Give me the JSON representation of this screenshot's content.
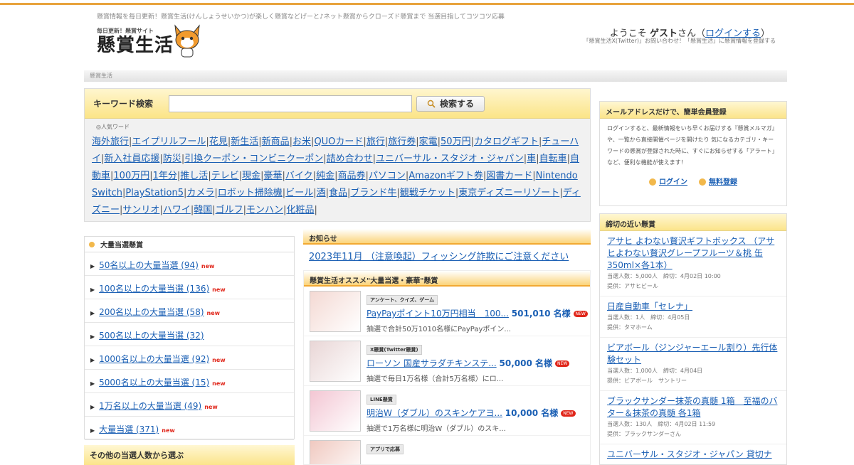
{
  "header": {
    "tagline": "懸賞情報を毎日更新！懸賞生活(けんしょうせいかつ)が楽しく懸賞などげーと♪ネット懸賞からクローズド懸賞まで 当選目指してコツコツ応募",
    "logo_small": "毎日更新！懸賞サイト",
    "logo_main": "懸賞生活",
    "welcome_prefix": "ようこそ",
    "welcome_user": "ゲスト",
    "welcome_suffix": "さん（",
    "login_link": "ログインする",
    "welcome_close": "）",
    "sublinks": "「懸賞生活X(Twitter)」お問い合わせ！「懸賞生活」に懸賞情報を登録する"
  },
  "breadcrumb": "懸賞生活",
  "search": {
    "label": "キーワード検索",
    "value": "",
    "button": "検索する",
    "popular_label": "人気ワード",
    "keywords": [
      "海外旅行",
      "エイプリルフール",
      "花見",
      "新生活",
      "新商品",
      "お米",
      "QUOカード",
      "旅行",
      "旅行券",
      "家電",
      "50万円",
      "カタログギフト",
      "チューハイ",
      "新入社員応援",
      "防災",
      "引換クーポン・コンビニクーポン",
      "詰め合わせ",
      "ユニバーサル・スタジオ・ジャパン",
      "車",
      "自転車",
      "自動車",
      "100万円",
      "1年分",
      "推し活",
      "テレビ",
      "現金",
      "豪華",
      "バイク",
      "純金",
      "商品券",
      "パソコン",
      "Amazonギフト券",
      "図書カード",
      "Nintendo Switch",
      "PlayStation5",
      "カメラ",
      "ロボット掃除機",
      "ビール",
      "酒",
      "食品",
      "ブランド牛",
      "観戦チケット",
      "東京ディズニーリゾート",
      "ディズニー",
      "サンリオ",
      "ハワイ",
      "韓国",
      "ゴルフ",
      "モンハン",
      "化粧品"
    ]
  },
  "member": {
    "title": "メールアドレスだけで、簡単会員登録",
    "text": "ログインすると、最新情報をいち早くお届けする『懸賞メルマガ』や、一覧から直接開催ページを開けたり 気になるカテゴリ・キーワードの懸賞が登録された時に、すぐにお知らせする「アラート」など、便利な機能が使えます！",
    "login": "ログイン",
    "register": "無料登録"
  },
  "deadline": {
    "title": "締切の近い懸賞",
    "items": [
      {
        "title": "アサヒ よわない贅沢ギフトボックス （アサヒよわない贅沢グレープフルーツ＆桃 缶350ml×各1本）",
        "meta1": "当選人数：5,000人　締切：4月02日 10:00",
        "meta2": "提供：アサヒビール"
      },
      {
        "title": "日産自動車「セレナ」",
        "meta1": "当選人数：1人　締切：4月05日",
        "meta2": "提供：タマホーム"
      },
      {
        "title": "ビアボール（ジンジャーエール割り）先行体験セット",
        "meta1": "当選人数：1,000人　締切：4月04日",
        "meta2": "提供：ビアボール　サントリー"
      },
      {
        "title": "ブラックサンダー抹茶の真髄 1箱　至福のバター＆抹茶の真髄 各1箱",
        "meta1": "当選人数：130人　締切：4月02日 11:59",
        "meta2": "提供：ブラックサンダーさん"
      },
      {
        "title": "ユニバーサル・スタジオ・ジャパン 貸切ナ",
        "meta1": "",
        "meta2": ""
      }
    ]
  },
  "bulk": {
    "title": "大量当選懸賞",
    "new_label": "new",
    "items": [
      {
        "label": "50名以上の大量当選",
        "count": "(94)",
        "new": true
      },
      {
        "label": "100名以上の大量当選",
        "count": "(136)",
        "new": true
      },
      {
        "label": "200名以上の大量当選",
        "count": "(58)",
        "new": true
      },
      {
        "label": "500名以上の大量当選",
        "count": "(32)",
        "new": false
      },
      {
        "label": "1000名以上の大量当選",
        "count": "(92)",
        "new": true
      },
      {
        "label": "5000名以上の大量当選",
        "count": "(15)",
        "new": true
      },
      {
        "label": "1万名以上の大量当選",
        "count": "(49)",
        "new": true
      },
      {
        "label": "大量当選",
        "count": "(371)",
        "new": true
      }
    ]
  },
  "other_head": "その他の当選人数から選ぶ",
  "news": {
    "title": "お知らせ",
    "link": "2023年11月 （注意喚起）フィッシング詐欺にご注意ください"
  },
  "recommend": {
    "title": "懸賞生活オススメ\"大量当選・豪華\"懸賞",
    "new_label": "NEW",
    "items": [
      {
        "category": "アンケート、クイズ、ゲーム",
        "title": "PayPayポイント10万円相当　100...",
        "count": "501,010 名様",
        "desc": "抽選で合計50万1010名様にPayPayポイン...",
        "thumb": "#f4d9d3"
      },
      {
        "category": "X懸賞(Twitter懸賞)",
        "title": "ローソン 国産サラダチキンステ...",
        "count": "50,000 名様",
        "desc": "抽選で毎日1万名様（合計5万名様）にロ...",
        "thumb": "#e9d6d6"
      },
      {
        "category": "LINE懸賞",
        "title": "明治W（ダブル）のスキンケアヨ...",
        "count": "10,000 名様",
        "desc": "抽選で1万名様に明治W（ダブル）のスキ...",
        "thumb": "#f3c6d3"
      },
      {
        "category": "アプリで応募",
        "title": "",
        "count": "",
        "desc": "",
        "thumb": "#f0c9c0"
      }
    ]
  }
}
